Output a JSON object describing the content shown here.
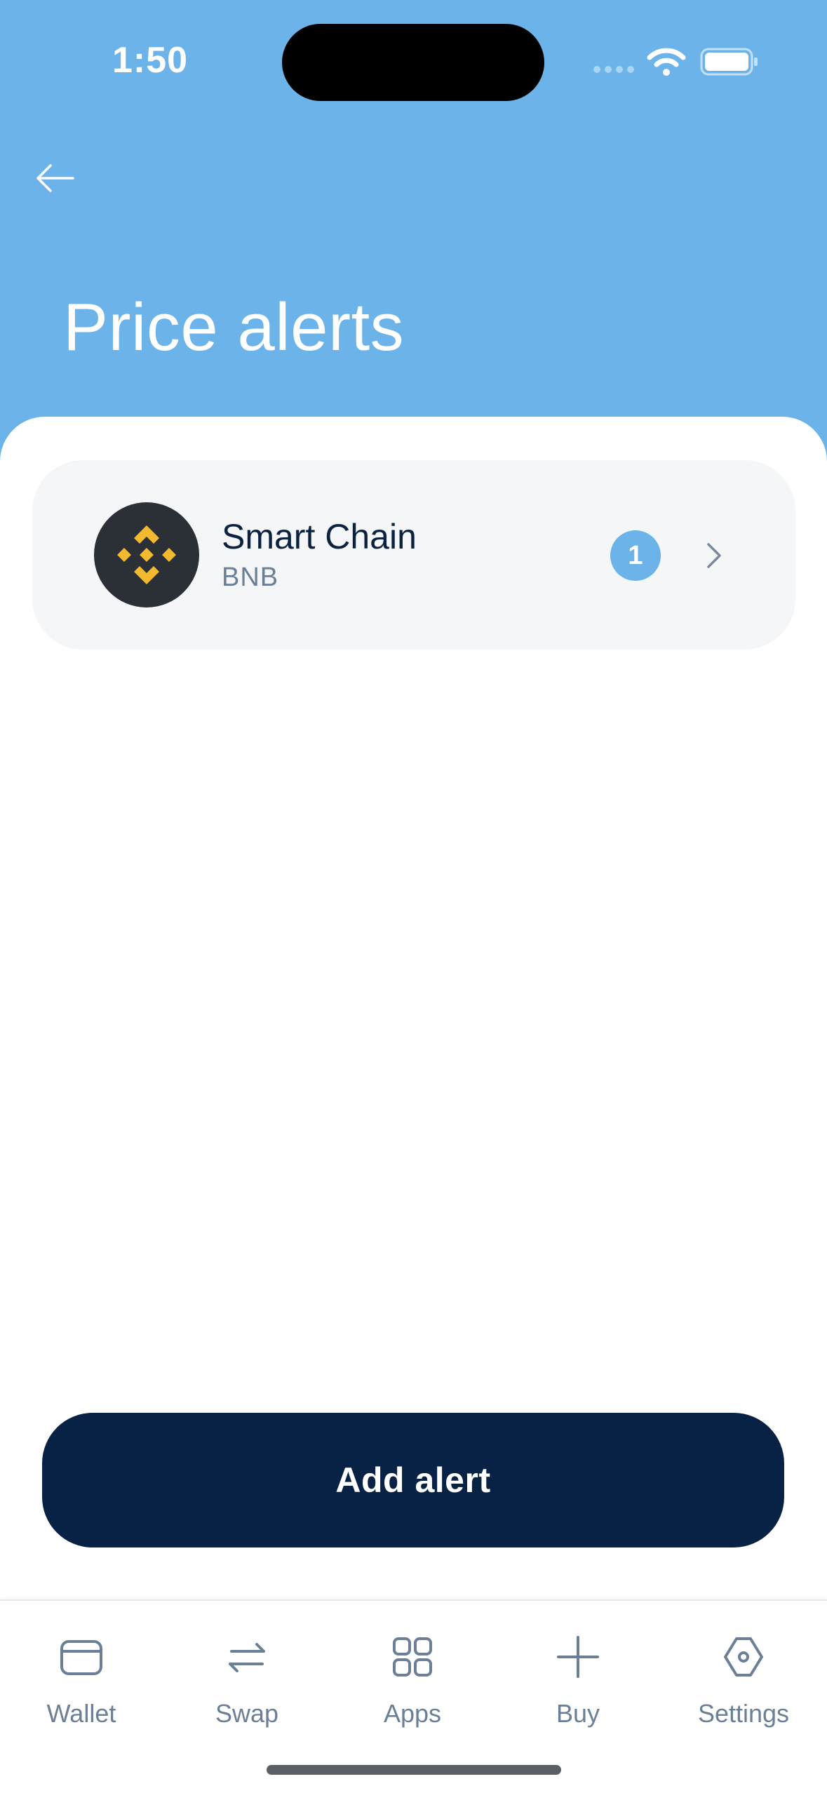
{
  "status_bar": {
    "time": "1:50"
  },
  "header": {
    "title": "Price alerts"
  },
  "alerts": [
    {
      "name": "Smart Chain",
      "symbol": "BNB",
      "count": "1",
      "icon": "bnb-logo-icon"
    }
  ],
  "actions": {
    "add_alert_label": "Add alert"
  },
  "tab_bar": {
    "items": [
      {
        "label": "Wallet",
        "icon": "wallet-icon"
      },
      {
        "label": "Swap",
        "icon": "swap-icon"
      },
      {
        "label": "Apps",
        "icon": "apps-icon"
      },
      {
        "label": "Buy",
        "icon": "plus-icon"
      },
      {
        "label": "Settings",
        "icon": "settings-icon"
      }
    ]
  },
  "colors": {
    "header_bg": "#6bb3e9",
    "primary_dark": "#082245",
    "card_bg": "#f4f6f8",
    "muted_text": "#6b7f96",
    "bnb_yellow": "#f3ba2f"
  }
}
